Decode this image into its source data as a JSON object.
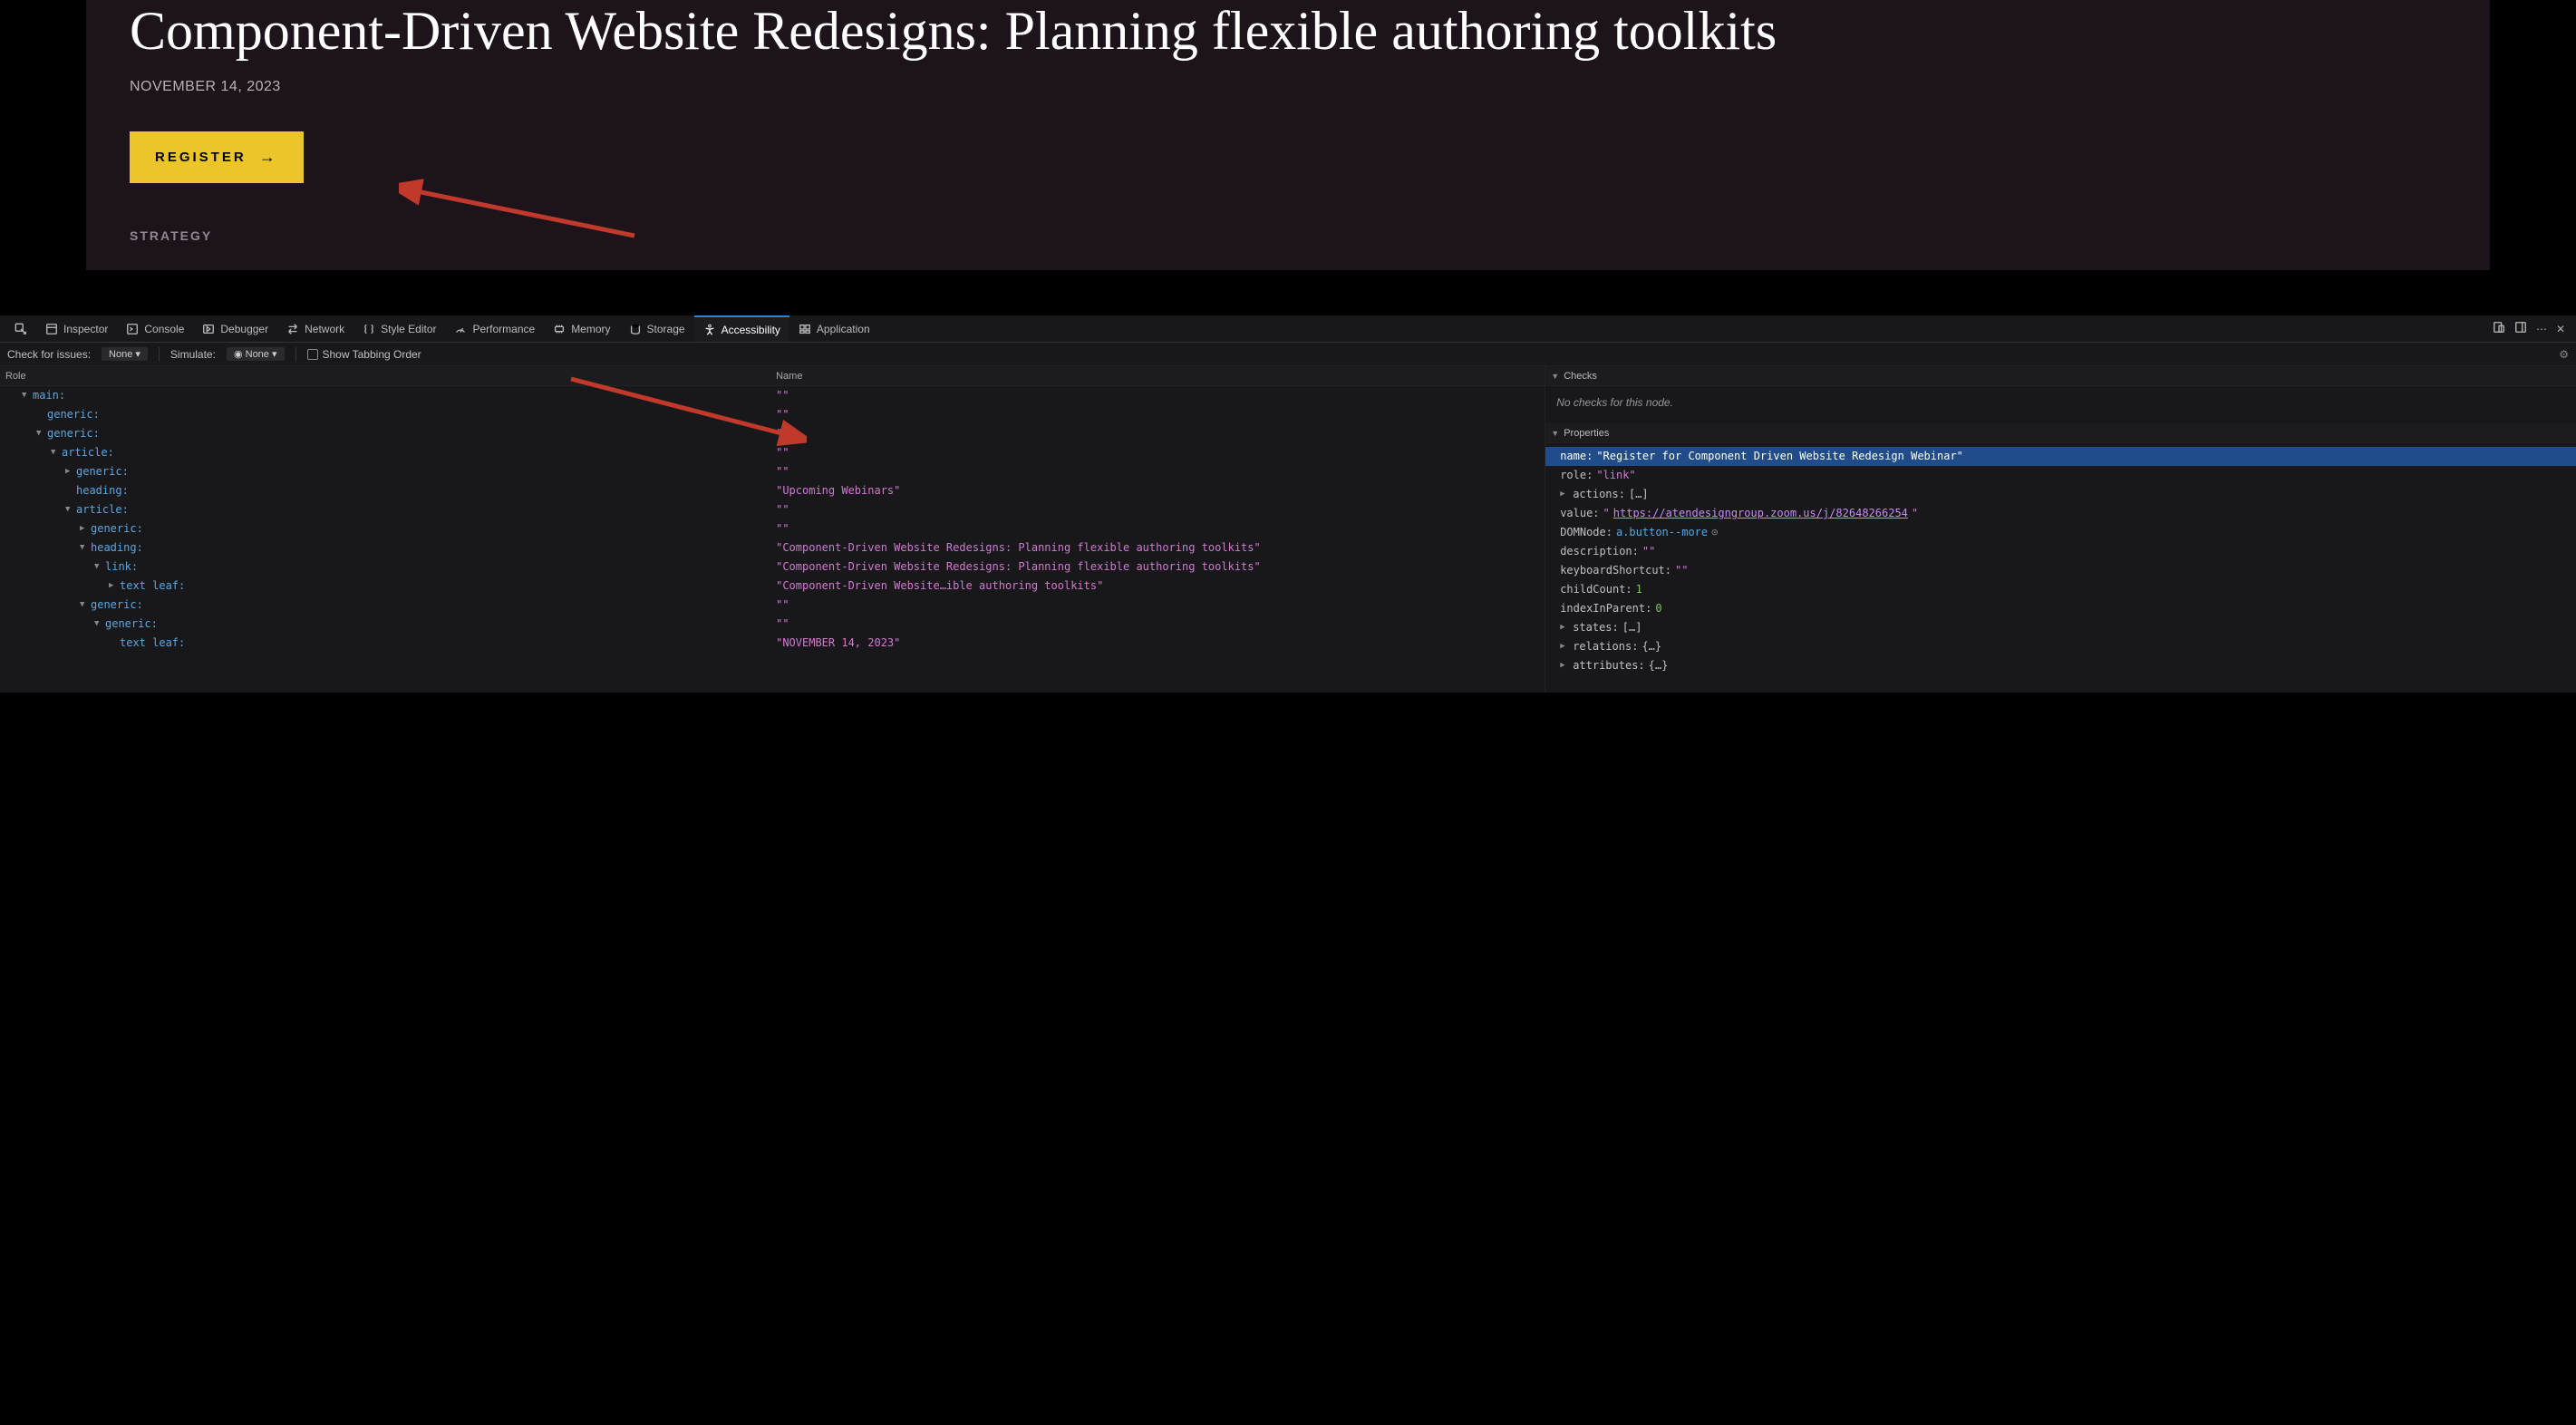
{
  "page": {
    "title": "Component-Driven Website Redesigns: Planning flexible authoring toolkits",
    "date": "NOVEMBER 14, 2023",
    "registerLabel": "REGISTER",
    "category": "STRATEGY"
  },
  "devtools": {
    "tabs": {
      "inspector": "Inspector",
      "console": "Console",
      "debugger": "Debugger",
      "network": "Network",
      "styleEditor": "Style Editor",
      "performance": "Performance",
      "memory": "Memory",
      "storage": "Storage",
      "accessibility": "Accessibility",
      "application": "Application"
    },
    "subbar": {
      "checkLabel": "Check for issues:",
      "checkValue": "None",
      "simulateLabel": "Simulate:",
      "simulateValue": "None",
      "tabbingLabel": "Show Tabbing Order"
    },
    "treeHeaders": {
      "role": "Role",
      "name": "Name"
    },
    "tree": [
      {
        "indent": 1,
        "twisty": "▼",
        "role": "main:",
        "name": "\"\""
      },
      {
        "indent": 2,
        "twisty": "",
        "role": "generic:",
        "name": "\"\""
      },
      {
        "indent": 2,
        "twisty": "▼",
        "role": "generic:",
        "name": "\"\""
      },
      {
        "indent": 3,
        "twisty": "▼",
        "role": "article:",
        "name": "\"\""
      },
      {
        "indent": 4,
        "twisty": "▶",
        "role": "generic:",
        "name": "\"\""
      },
      {
        "indent": 4,
        "twisty": "",
        "role": "heading:",
        "name": "\"Upcoming Webinars\""
      },
      {
        "indent": 4,
        "twisty": "▼",
        "role": "article:",
        "name": "\"\""
      },
      {
        "indent": 5,
        "twisty": "▶",
        "role": "generic:",
        "name": "\"\""
      },
      {
        "indent": 5,
        "twisty": "▼",
        "role": "heading:",
        "name": "\"Component-Driven Website Redesigns: Planning flexible authoring toolkits\""
      },
      {
        "indent": 6,
        "twisty": "▼",
        "role": "link:",
        "name": "\"Component-Driven Website Redesigns: Planning flexible authoring toolkits\""
      },
      {
        "indent": 7,
        "twisty": "▶",
        "role": "text leaf:",
        "name": "\"Component-Driven Website…ible authoring toolkits\""
      },
      {
        "indent": 5,
        "twisty": "▼",
        "role": "generic:",
        "name": "\"\""
      },
      {
        "indent": 6,
        "twisty": "▼",
        "role": "generic:",
        "name": "\"\""
      },
      {
        "indent": 7,
        "twisty": "",
        "role": "text leaf:",
        "name": "\"NOVEMBER 14, 2023\""
      }
    ],
    "propsHeaders": {
      "checks": "Checks",
      "properties": "Properties"
    },
    "checksNone": "No checks for this node.",
    "properties": {
      "name": {
        "key": "name:",
        "val": "\"Register for Component Driven Website Redesign Webinar\""
      },
      "role": {
        "key": "role:",
        "val": "\"link\""
      },
      "actions": {
        "key": "actions:",
        "val": "[…]"
      },
      "value": {
        "key": "value:",
        "pre": "\"",
        "url": "https://atendesigngroup.zoom.us/j/82648266254",
        "post": "\""
      },
      "domnode": {
        "key": "DOMNode:",
        "val": "a.button--more"
      },
      "description": {
        "key": "description:",
        "val": "\"\""
      },
      "keyboardShortcut": {
        "key": "keyboardShortcut:",
        "val": "\"\""
      },
      "childCount": {
        "key": "childCount:",
        "val": "1"
      },
      "indexInParent": {
        "key": "indexInParent:",
        "val": "0"
      },
      "states": {
        "key": "states:",
        "val": "[…]"
      },
      "relations": {
        "key": "relations:",
        "val": "{…}"
      },
      "attributes": {
        "key": "attributes:",
        "val": "{…}"
      }
    }
  }
}
